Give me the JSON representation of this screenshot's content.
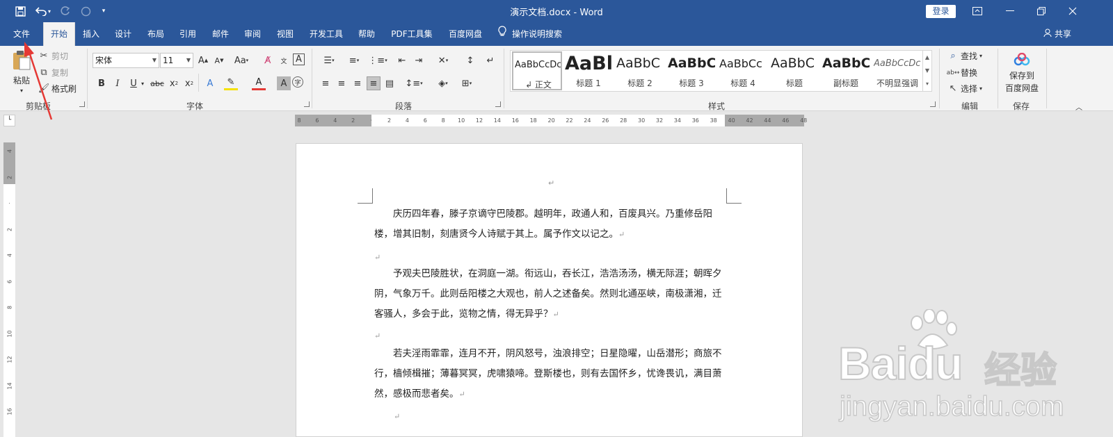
{
  "titlebar": {
    "doc_title": "演示文档.docx  -  Word",
    "login_label": "登录",
    "icons": [
      "save-icon",
      "undo-icon",
      "redo-icon",
      "touch-mode-icon",
      "customize-qat-icon",
      "ribbon-display-icon",
      "minimize-icon",
      "restore-icon",
      "close-icon"
    ]
  },
  "tabs": [
    {
      "label": "文件"
    },
    {
      "label": "开始",
      "active": true
    },
    {
      "label": "插入"
    },
    {
      "label": "设计"
    },
    {
      "label": "布局"
    },
    {
      "label": "引用"
    },
    {
      "label": "邮件"
    },
    {
      "label": "审阅"
    },
    {
      "label": "视图"
    },
    {
      "label": "开发工具"
    },
    {
      "label": "帮助"
    },
    {
      "label": "PDF工具集"
    },
    {
      "label": "百度网盘"
    }
  ],
  "tell_me": "操作说明搜索",
  "share_label": "共享",
  "clipboard": {
    "paste": "粘贴",
    "cut": "剪切",
    "copy": "复制",
    "format_painter": "格式刷",
    "group": "剪贴板"
  },
  "font": {
    "name": "宋体",
    "size": "11",
    "group": "字体",
    "aa": "Aa"
  },
  "paragraph": {
    "group": "段落"
  },
  "styles": {
    "group": "样式",
    "items": [
      {
        "sample": "AaBbCcDc",
        "label": "↲ 正文",
        "selected": true
      },
      {
        "sample": "AaBl",
        "label": "标题 1"
      },
      {
        "sample": "AaBbC",
        "label": "标题 2"
      },
      {
        "sample": "AaBbC",
        "label": "标题 3"
      },
      {
        "sample": "AaBbCc",
        "label": "标题 4"
      },
      {
        "sample": "AaBbC",
        "label": "标题"
      },
      {
        "sample": "AaBbC",
        "label": "副标题"
      },
      {
        "sample": "AaBbCcDc",
        "label": "不明显强调"
      }
    ]
  },
  "editing": {
    "find": "查找",
    "replace": "替换",
    "select": "选择",
    "group": "编辑"
  },
  "save": {
    "label_line1": "保存到",
    "label_line2": "百度网盘",
    "group": "保存"
  },
  "ruler": {
    "h_ticks": [
      "8",
      "6",
      "4",
      "2",
      "",
      "2",
      "4",
      "6",
      "8",
      "10",
      "12",
      "14",
      "16",
      "18",
      "20",
      "22",
      "24",
      "26",
      "28",
      "30",
      "32",
      "34",
      "36",
      "38",
      "40",
      "42",
      "44",
      "46",
      "48"
    ],
    "v_ticks": [
      "4",
      "2",
      "",
      "2",
      "4",
      "6",
      "8",
      "10",
      "12",
      "14",
      "16"
    ]
  },
  "document": {
    "paragraphs": [
      {
        "text": "庆历四年春，滕子京谪守巴陵郡。越明年，政通人和，百废具兴。乃重修岳阳楼，增其旧制，刻唐贤今人诗赋于其上。属予作文以记之。"
      },
      {
        "text": ""
      },
      {
        "text": "予观夫巴陵胜状，在洞庭一湖。衔远山，吞长江，浩浩汤汤，横无际涯；朝晖夕阴，气象万千。此则岳阳楼之大观也，前人之述备矣。然则北通巫峡，南极潇湘，迁客骚人，多会于此，览物之情，得无异乎？"
      },
      {
        "text": ""
      },
      {
        "text": "若夫淫雨霏霏，连月不开，阴风怒号，浊浪排空；日星隐曜，山岳潜形；商旅不行，樯倾楫摧；薄暮冥冥，虎啸猿啼。登斯楼也，则有去国怀乡，忧谗畏讥，满目萧然，感极而悲者矣。"
      },
      {
        "text": ""
      }
    ]
  },
  "watermark": {
    "brand": "Baidu",
    "cn": "经验",
    "url": "jingyan.baidu.com"
  },
  "colors": {
    "word_blue": "#2b579a",
    "annotation_red": "#e53935"
  }
}
